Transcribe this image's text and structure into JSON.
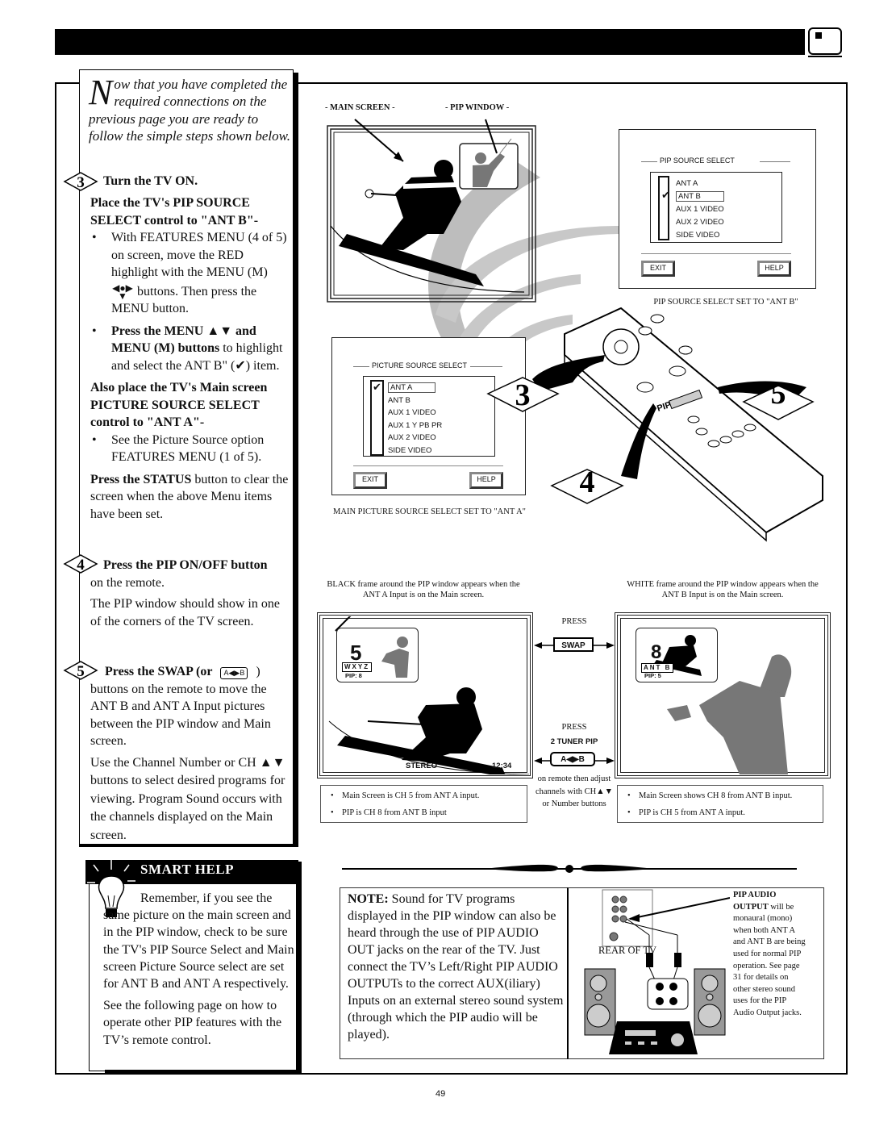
{
  "header": {
    "bar_color": "#000000",
    "tv_icon": "tv-icon"
  },
  "intro": {
    "drop_cap": "N",
    "text": "ow that you have completed the required connections on the previous page you are ready to follow the simple steps shown below."
  },
  "step3": {
    "number": "3",
    "title": "Turn the TV ON.",
    "heading1": "Place the TV's PIP SOURCE SELECT control to \"ANT B\"-",
    "bullet1_a": "With FEATURES MENU (4 of 5) on screen, move the RED highlight with the MENU (M)",
    "bullet1_b": "buttons. Then press the MENU button.",
    "bullet2_bold": "Press the MENU ▲▼ and MENU (M) buttons",
    "bullet2_rest": " to highlight and select the ANT B\" (✔) item.",
    "heading2": "Also place the TV's Main screen PICTURE SOURCE SELECT control to \"ANT A\"-",
    "bullet3": "See the Picture Source option FEATURES MENU (1 of 5).",
    "status_bold": "Press the STATUS",
    "status_rest": " button to clear the screen when the above Menu items have been set."
  },
  "step4": {
    "number": "4",
    "title": "Press the PIP ON/OFF button",
    "title_rest": "on the remote.",
    "para": "The PIP window should show in one of the corners of the TV screen."
  },
  "step5": {
    "number": "5",
    "title": "Press the SWAP (or",
    "title_icon": "A◀▶B",
    "title_end": ")",
    "para1": "buttons on the remote to move the ANT B and ANT A Input pictures between the PIP window and Main screen.",
    "para2": "Use the Channel Number or CH ▲▼ buttons to select desired programs for viewing. Program Sound occurs with the channels displayed on the Main screen."
  },
  "smart_help": {
    "title": "SMART HELP",
    "para1": "Remember, if you see the same picture on the main screen and in the PIP window, check to be sure the TV's PIP Source Select and Main screen Picture Source select are set for ANT B and ANT A respectively.",
    "para2": "See the following page on how to operate other PIP features with the TV’s remote control."
  },
  "diagram_top": {
    "label_main": "- MAIN SCREEN -",
    "label_pip": "- PIP WINDOW -"
  },
  "pip_menu": {
    "title": "PIP SOURCE SELECT",
    "items": [
      "ANT A",
      "ANT B",
      "AUX 1  VIDEO",
      "AUX 2  VIDEO",
      "SIDE VIDEO"
    ],
    "selected": "ANT B",
    "exit": "EXIT",
    "help": "HELP",
    "caption": "PIP SOURCE SELECT SET TO \"ANT B\""
  },
  "picture_menu": {
    "title": "PICTURE SOURCE SELECT",
    "items": [
      "ANT A",
      "ANT B",
      "AUX 1  VIDEO",
      "AUX 1  Y PB PR",
      "AUX 2  VIDEO",
      "SIDE VIDEO"
    ],
    "selected": "ANT A",
    "exit": "EXIT",
    "help": "HELP",
    "caption": "MAIN PICTURE SOURCE SELECT SET TO \"ANT A\""
  },
  "remote_callouts": [
    "3",
    "4",
    "5"
  ],
  "remote_label": "PIP",
  "swap_section": {
    "left_caption": "BLACK frame around the PIP window appears when the ANT A Input is on the Main screen.",
    "right_caption": "WHITE frame around the PIP window appears when the ANT B Input is on the Main screen.",
    "press1": "PRESS",
    "swap_button": "SWAP",
    "press2": "PRESS",
    "tuner_label": "2 TUNER PIP",
    "tuner_button": "A◀▶B",
    "tuner_note": "on remote then adjust channels with CH▲▼ or Number buttons",
    "left_pip": {
      "channel": "5",
      "station": "WXYZ",
      "pip": "PIP: 8"
    },
    "left_status": {
      "audio": "STEREO",
      "time": "12:34"
    },
    "right_pip": {
      "channel": "8",
      "station": "ANT B",
      "pip": "PIP: 5"
    },
    "left_notes": [
      "Main Screen is CH 5 from ANT A input.",
      "PIP is CH 8 from ANT B input"
    ],
    "right_notes": [
      "Main Screen shows CH 8 from ANT B input.",
      "PIP is CH 5 from ANT A input."
    ]
  },
  "note": {
    "bold": "NOTE:",
    "text": " Sound for TV programs displayed in the PIP window can also be heard through the use of PIP AUDIO OUT jacks on the rear of the TV. Just connect the TV’s Left/Right PIP AUDIO OUTPUTs to the correct AUX(iliary) Inputs on an external stereo sound system (through which the PIP audio will be played)."
  },
  "audio_diagram": {
    "rear_label": "REAR OF TV",
    "side_bold": "PIP AUDIO OUTPUT",
    "side_text": " will be monaural (mono) when both ANT A and ANT B are being used for normal PIP operation. See page 31 for details on other stereo sound uses for the PIP Audio Output jacks."
  },
  "page_number": "49"
}
